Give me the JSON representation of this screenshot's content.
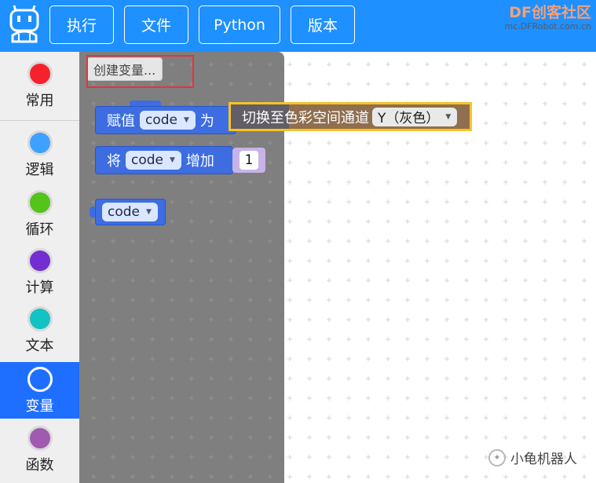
{
  "topbar": {
    "menu": {
      "run": "执行",
      "file": "文件",
      "python": "Python",
      "version": "版本"
    },
    "brand_main": "DF创客社区",
    "brand_sub": "mc.DFRobot.com.cn",
    "color": "#1e90ff"
  },
  "sidebar": {
    "categories": [
      {
        "label": "常用",
        "color": "#f5222d"
      },
      {
        "label": "逻辑",
        "color": "#3ea0ff"
      },
      {
        "label": "循环",
        "color": "#52c41a"
      },
      {
        "label": "计算",
        "color": "#722ed1"
      },
      {
        "label": "文本",
        "color": "#13c2c2"
      },
      {
        "label": "变量",
        "color": "#1e6fff"
      },
      {
        "label": "函数",
        "color": "#a05bb0"
      }
    ],
    "selected": "变量"
  },
  "flyout": {
    "create_variable": "创建变量...",
    "set_block": {
      "prefix": "赋值",
      "var": "code",
      "suffix": "为"
    },
    "change_block": {
      "prefix": "将",
      "var": "code",
      "middle": "增加",
      "amount": "1"
    },
    "get_block": {
      "var": "code"
    }
  },
  "dragged_block": {
    "label": "切换至色彩空间通道",
    "option": "Y（灰色）",
    "highlight_color": "#f5c424"
  },
  "watermark": {
    "text": "小龟机器人"
  },
  "icons": {
    "logo": "robot-logo-icon",
    "dropdown": "dropdown-arrow-icon",
    "wechat": "wechat-icon"
  }
}
